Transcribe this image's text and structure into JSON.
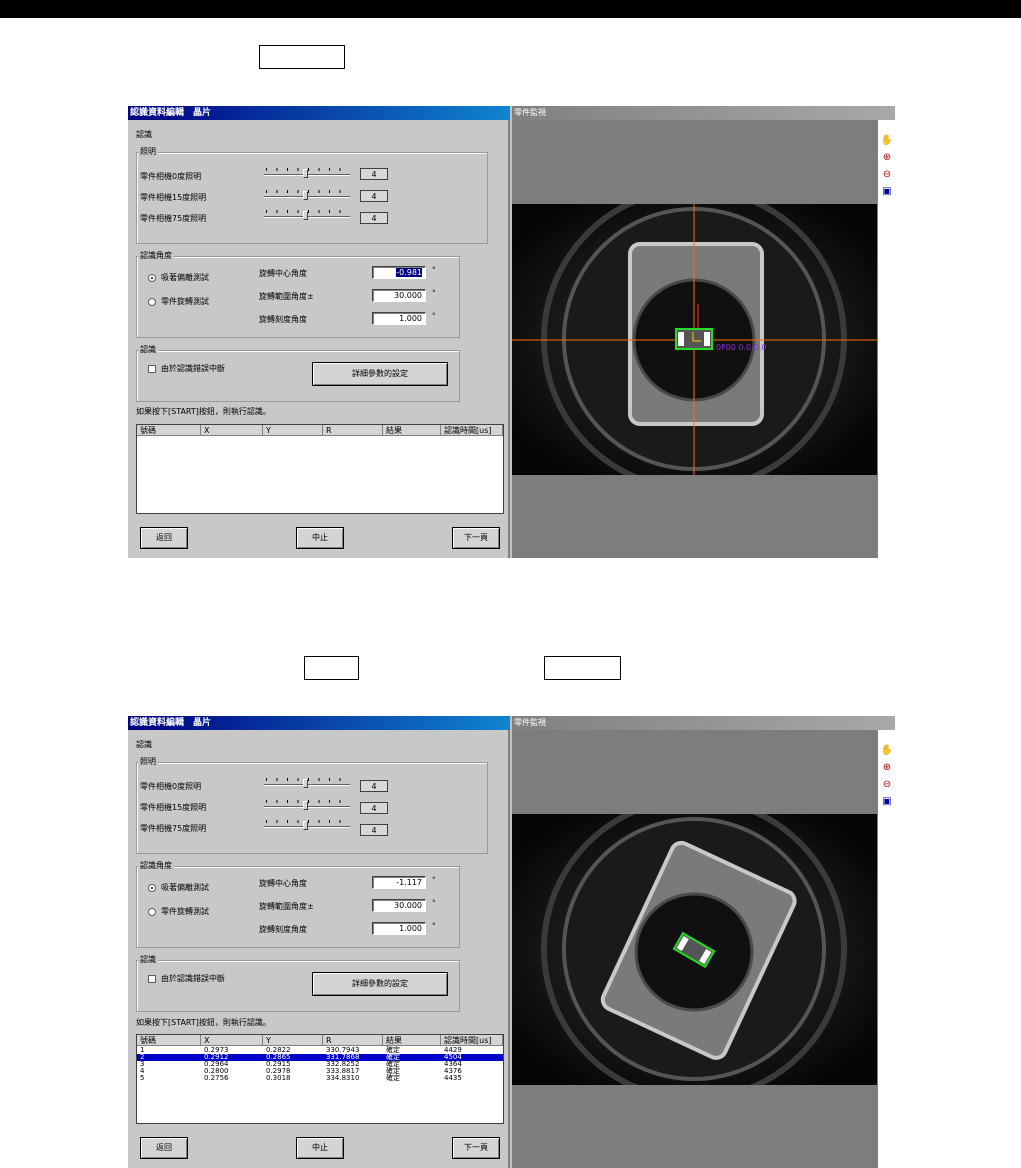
{
  "screens": [
    {
      "window_title": "認識資料編輯　晶片",
      "section_recognition": "認識",
      "lighting_group": "照明",
      "lighting": [
        {
          "label": "零件相機0度照明",
          "value": "4"
        },
        {
          "label": "零件相機15度照明",
          "value": "4"
        },
        {
          "label": "零件相機75度照明",
          "value": "4"
        }
      ],
      "angle_group": "認識角度",
      "radio_pick": "吸著偏離測試",
      "radio_rotate": "零件旋轉測試",
      "rot_center_label": "旋轉中心角度",
      "rot_center_value": "-0.981",
      "rot_range_label": "旋轉範圍角度±",
      "rot_range_value": "30.000",
      "rot_step_label": "旋轉刻度角度",
      "rot_step_value": "1.000",
      "degree_symbol": "°",
      "recog_group": "認識",
      "abort_checkbox_label": "由於認識錯誤中斷",
      "detail_button": "詳細參數的設定",
      "hint": "如果按下[START]按鈕，則執行認識。",
      "columns": [
        "號碼",
        "X",
        "Y",
        "R",
        "結果",
        "認識時間[us]"
      ],
      "rows": [],
      "back_button": "返回",
      "stop_button": "中止",
      "next_button": "下一頁",
      "view_title": "零件監視",
      "overlay_label": "0F00  0.0  0.0"
    },
    {
      "window_title": "認識資料編輯　晶片",
      "section_recognition": "認識",
      "lighting_group": "照明",
      "lighting": [
        {
          "label": "零件相機0度照明",
          "value": "4"
        },
        {
          "label": "零件相機15度照明",
          "value": "4"
        },
        {
          "label": "零件相機75度照明",
          "value": "4"
        }
      ],
      "angle_group": "認識角度",
      "radio_pick": "吸著偏離測試",
      "radio_rotate": "零件旋轉測試",
      "rot_center_label": "旋轉中心角度",
      "rot_center_value": "-1.117",
      "rot_range_label": "旋轉範圍角度±",
      "rot_range_value": "30.000",
      "rot_step_label": "旋轉刻度角度",
      "rot_step_value": "1.000",
      "degree_symbol": "°",
      "recog_group": "認識",
      "abort_checkbox_label": "由於認識錯誤中斷",
      "detail_button": "詳細參數的設定",
      "hint": "如果按下[START]按鈕，則執行認識。",
      "columns": [
        "號碼",
        "X",
        "Y",
        "R",
        "結果",
        "認識時間[us]"
      ],
      "rows": [
        [
          "1",
          "0.2973",
          "0.2822",
          "330.7943",
          "確定",
          "4429"
        ],
        [
          "2",
          "0.2912",
          "0.2865",
          "331.7868",
          "確定",
          "4504"
        ],
        [
          "3",
          "0.2964",
          "0.2915",
          "332.8252",
          "確定",
          "4364"
        ],
        [
          "4",
          "0.2800",
          "0.2978",
          "333.8817",
          "確定",
          "4376"
        ],
        [
          "5",
          "0.2756",
          "0.3018",
          "334.8310",
          "確定",
          "4435"
        ]
      ],
      "selected_row": 2,
      "back_button": "返回",
      "stop_button": "中止",
      "next_button": "下一頁",
      "view_title": "零件監視"
    }
  ],
  "colors": {
    "title_bar": "#000080",
    "selection": "#0000c8",
    "crosshair": "#ff6a00",
    "detect_box": "#22dd22",
    "overlay_text": "#8a2be2"
  }
}
